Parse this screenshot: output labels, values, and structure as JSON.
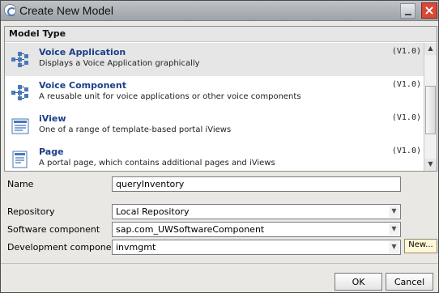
{
  "window": {
    "title": "Create New Model",
    "minimize_glyph": "",
    "close_glyph": "×"
  },
  "model_panel": {
    "header": "Model Type",
    "items": [
      {
        "name": "Voice Application",
        "description": "Displays a Voice Application graphically",
        "version": "(V1.0)",
        "icon": "voice-application-icon"
      },
      {
        "name": "Voice Component",
        "description": "A reusable unit for voice applications or other voice components",
        "version": "(V1.0)",
        "icon": "voice-component-icon"
      },
      {
        "name": "iView",
        "description": "One of a range of template-based portal iViews",
        "version": "(V1.0)",
        "icon": "iview-icon"
      },
      {
        "name": "Page",
        "description": "A portal page, which contains additional pages and iViews",
        "version": "(V1.0)",
        "icon": "page-icon"
      }
    ],
    "selected_item": "Voice Application"
  },
  "form": {
    "name_label": "Name",
    "name_value": "queryInventory",
    "repository_label": "Repository",
    "repository_value": "Local Repository",
    "software_component_label": "Software component",
    "software_component_value": "sap.com_UWSoftwareComponent",
    "development_component_label": "Development component",
    "development_component_value": "invmgmt",
    "new_button_label": "New..."
  },
  "footer": {
    "ok_label": "OK",
    "cancel_label": "Cancel"
  }
}
